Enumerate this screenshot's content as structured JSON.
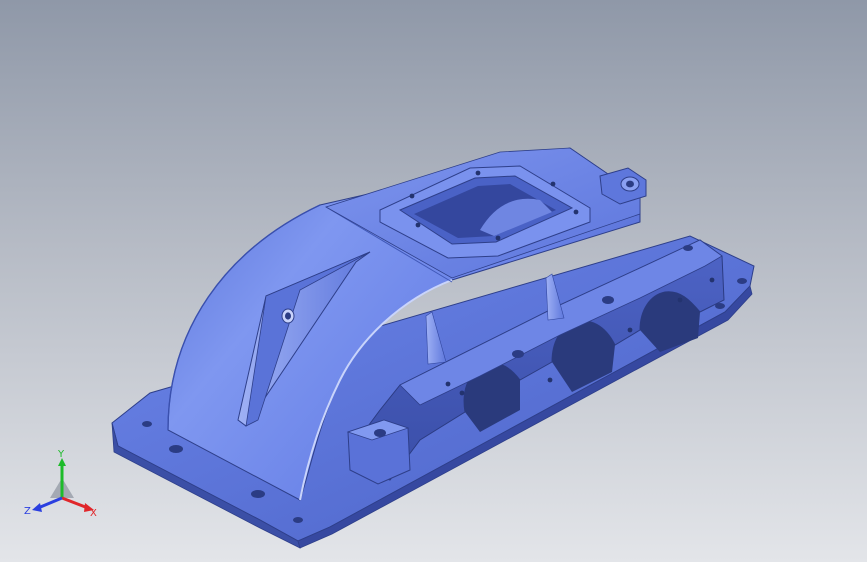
{
  "view": {
    "background_top": "#8f98a8",
    "background_bottom": "#e3e5e9",
    "model_color": "#5f79e3"
  },
  "triad": {
    "x_label": "X",
    "y_label": "Y",
    "z_label": "Z",
    "x_color": "#e0262a",
    "y_color": "#1dbb2a",
    "z_color": "#2a3fe0"
  }
}
